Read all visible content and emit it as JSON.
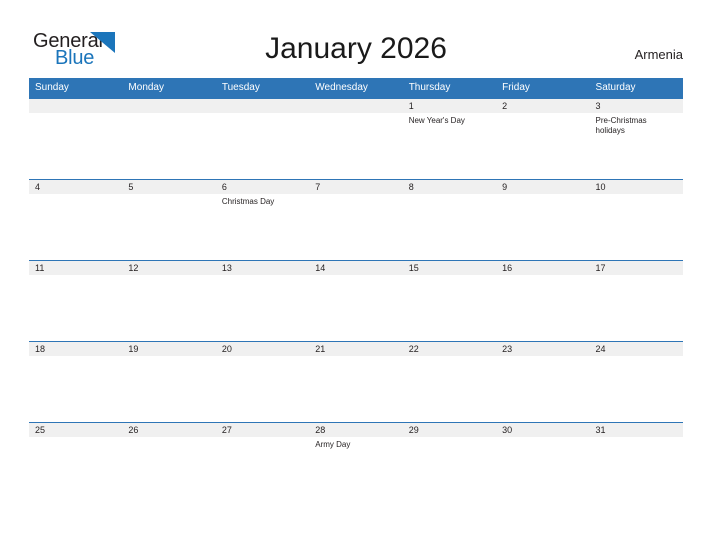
{
  "logo": {
    "word_one": "General",
    "word_two": "Blue",
    "flag_icon": "blue-triangle-flag-icon",
    "dark_color": "#231f20",
    "blue_color": "#1b75bb"
  },
  "header": {
    "title": "January 2026",
    "country": "Armenia"
  },
  "colors": {
    "header_blue": "#2e75b6",
    "date_band_gray": "#f0f0f0",
    "text_dark": "#231f20",
    "header_text": "#ffffff"
  },
  "calendar": {
    "weekday_headers": [
      "Sunday",
      "Monday",
      "Tuesday",
      "Wednesday",
      "Thursday",
      "Friday",
      "Saturday"
    ],
    "weeks": [
      {
        "dates": [
          "",
          "",
          "",
          "",
          "1",
          "2",
          "3"
        ],
        "events": [
          "",
          "",
          "",
          "",
          "New Year's Day",
          "",
          "Pre-Christmas holidays"
        ]
      },
      {
        "dates": [
          "4",
          "5",
          "6",
          "7",
          "8",
          "9",
          "10"
        ],
        "events": [
          "",
          "",
          "Christmas Day",
          "",
          "",
          "",
          ""
        ]
      },
      {
        "dates": [
          "11",
          "12",
          "13",
          "14",
          "15",
          "16",
          "17"
        ],
        "events": [
          "",
          "",
          "",
          "",
          "",
          "",
          ""
        ]
      },
      {
        "dates": [
          "18",
          "19",
          "20",
          "21",
          "22",
          "23",
          "24"
        ],
        "events": [
          "",
          "",
          "",
          "",
          "",
          "",
          ""
        ]
      },
      {
        "dates": [
          "25",
          "26",
          "27",
          "28",
          "29",
          "30",
          "31"
        ],
        "events": [
          "",
          "",
          "",
          "Army Day",
          "",
          "",
          ""
        ]
      }
    ]
  }
}
